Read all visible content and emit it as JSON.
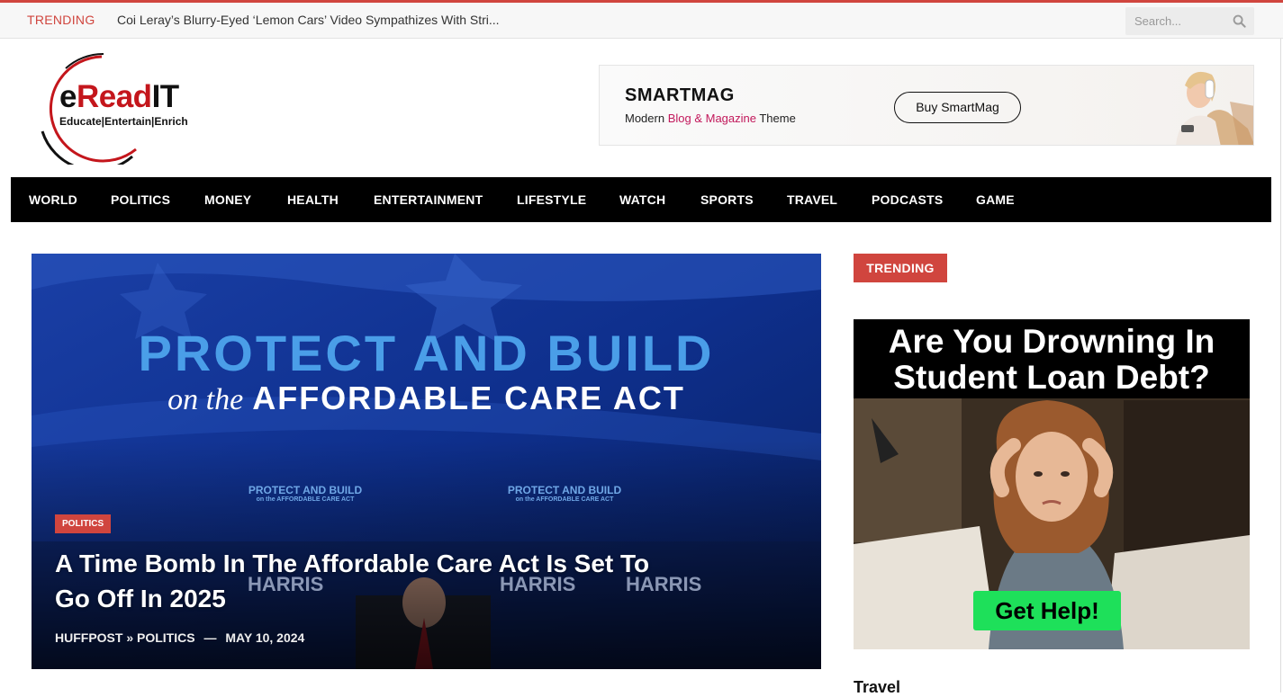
{
  "topbar": {
    "trending_label": "TRENDING",
    "trending_headline": "Coi Leray’s Blurry-Eyed ‘Lemon Cars’ Video Sympathizes With Stri...",
    "search_placeholder": "Search..."
  },
  "logo": {
    "brand_e": "e",
    "brand_read": "Read",
    "brand_it": "IT",
    "tagline": "Educate|Entertain|Enrich"
  },
  "ad_banner": {
    "title": "SMARTMAG",
    "sub_prefix": "Modern ",
    "sub_highlight": "Blog & Magazine",
    "sub_suffix": " Theme",
    "button": "Buy SmartMag"
  },
  "nav": {
    "items": [
      "WORLD",
      "POLITICS",
      "MONEY",
      "HEALTH",
      "ENTERTAINMENT",
      "LIFESTYLE",
      "WATCH",
      "SPORTS",
      "TRAVEL",
      "PODCASTS",
      "GAME"
    ]
  },
  "hero": {
    "image_text_main": "PROTECT AND BUILD",
    "image_text_sub_italic": "on the",
    "image_text_sub": "AFFORDABLE CARE ACT",
    "image_small_main": "PROTECT AND BUILD",
    "image_small_sub": "on the AFFORDABLE CARE ACT",
    "image_sign": "HARRIS",
    "category": "POLITICS",
    "title": "A Time Bomb In The Affordable Care Act Is Set To Go Off In 2025",
    "source": "HUFFPOST » POLITICS",
    "separator": "—",
    "date": "MAY 10, 2024"
  },
  "sidebar": {
    "section_label": "TRENDING",
    "ad_headline": "Are You Drowning In Student Loan Debt?",
    "ad_button": "Get Help!",
    "next_section": "Travel"
  },
  "colors": {
    "accent": "#d0453e",
    "nav_bg": "#000000",
    "hero_bg": "#0d2f86",
    "ad_cta": "#1ee05a"
  }
}
